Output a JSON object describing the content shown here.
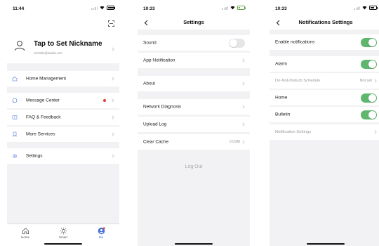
{
  "screen1": {
    "status_time": "11:44",
    "nickname": "Tap to Set Nickname",
    "email": "michelle@tuwdia.com",
    "menu": [
      {
        "label": "Home Management",
        "icon": "home-icon"
      },
      {
        "label": "Message Center",
        "icon": "message-icon",
        "badge": true
      },
      {
        "label": "FAQ & Feedback",
        "icon": "book-icon"
      },
      {
        "label": "More Services",
        "icon": "bookmark-icon"
      },
      {
        "label": "Settings",
        "icon": "gear-icon"
      }
    ],
    "tabs": [
      {
        "label": "Home",
        "icon": "home-icon"
      },
      {
        "label": "Smart",
        "icon": "sun-icon"
      },
      {
        "label": "Me",
        "icon": "person-icon",
        "active": true
      }
    ],
    "accent": "#4a6fd6"
  },
  "screen2": {
    "status_time": "10:33",
    "title": "Settings",
    "rows": [
      {
        "label": "Sound",
        "toggle": false
      },
      {
        "label": "App Notification"
      },
      {
        "label": "About"
      },
      {
        "label": "Network Diagnosis"
      },
      {
        "label": "Upload Log"
      },
      {
        "label": "Clear Cache",
        "value": "0.03M"
      }
    ],
    "logout": "Log Out"
  },
  "screen3": {
    "status_time": "10:33",
    "title": "Notifications Settings",
    "rows": [
      {
        "label": "Enable notifications",
        "toggle": true
      },
      {
        "label": "Alarm",
        "toggle": true
      },
      {
        "label": "Do-Not-Disturb Schedule",
        "value": "Not set"
      },
      {
        "label": "Home",
        "toggle": true
      },
      {
        "label": "Bulletin",
        "toggle": true
      },
      {
        "label": "Notification Settings"
      }
    ],
    "toggle_on_color": "#5fb66d"
  }
}
